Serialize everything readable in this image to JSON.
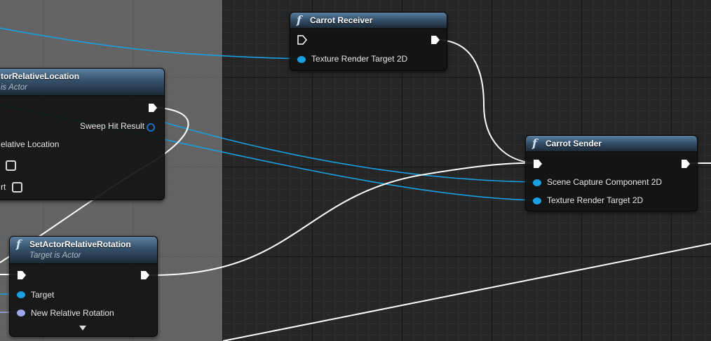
{
  "nodes": {
    "set_location": {
      "title": "SetActorRelativeLocation",
      "title_visible": "torRelativeLocation",
      "subtitle": "Target is Actor",
      "subtitle_visible": "is Actor",
      "pins": {
        "sweep_hit_result": "Sweep Hit Result",
        "new_relative_location": "New Relative Location",
        "new_relative_location_visible": "elative Location",
        "teleport": "Teleport",
        "teleport_visible": "rt"
      }
    },
    "set_rotation": {
      "title": "SetActorRelativeRotation",
      "subtitle": "Target is Actor",
      "pins": {
        "target": "Target",
        "new_relative_rotation": "New Relative Rotation"
      }
    },
    "carrot_receiver": {
      "title": "Carrot Receiver",
      "pins": {
        "texture_render_target": "Texture Render Target 2D"
      }
    },
    "carrot_sender": {
      "title": "Carrot Sender",
      "pins": {
        "scene_capture": "Scene Capture Component 2D",
        "texture_render_target": "Texture Render Target 2D"
      }
    }
  },
  "colors": {
    "exec_wire": "#ffffff",
    "object_wire": "#1a9fe0",
    "rotator_pin": "#9fa6e8",
    "function_header": "#4e6e8c",
    "graph_background": "#262626",
    "comment_box": "#7a7a7a"
  },
  "icons": {
    "function": "f",
    "exec_pin": "exec-arrow",
    "data_pin": "filled-circle",
    "expand": "down-triangle"
  }
}
